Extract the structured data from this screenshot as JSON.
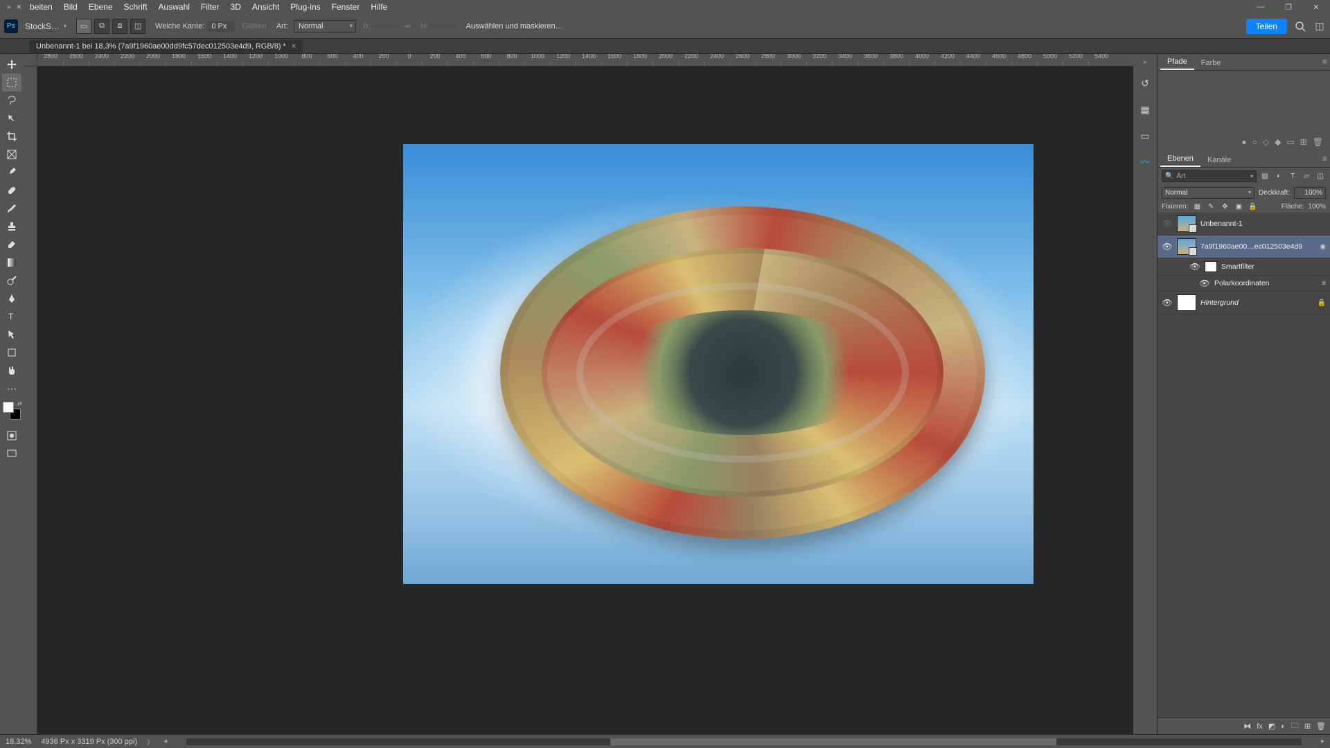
{
  "menu": {
    "items": [
      "beiten",
      "Bild",
      "Ebene",
      "Schrift",
      "Auswahl",
      "Filter",
      "3D",
      "Ansicht",
      "Plug-ins",
      "Fenster",
      "Hilfe"
    ]
  },
  "app": {
    "home_label": "StockS…"
  },
  "options": {
    "feather_label": "Weiche Kante:",
    "feather_value": "0 Px",
    "antialias": "Glätten",
    "style_label": "Art:",
    "style_value": "Normal",
    "width_label": "B:",
    "height_label": "H:",
    "mask_button": "Auswählen und maskieren…",
    "share": "Teilen"
  },
  "document": {
    "tab_title": "Unbenannt-1 bei 18,3% (7a9f1960ae00dd9fc57dec012503e4d9, RGB/8) *"
  },
  "ruler": {
    "ticks": [
      "2800",
      "2600",
      "2400",
      "2200",
      "2000",
      "1800",
      "1600",
      "1400",
      "1200",
      "1000",
      "800",
      "600",
      "400",
      "200",
      "0",
      "200",
      "400",
      "600",
      "800",
      "1000",
      "1200",
      "1400",
      "1600",
      "1800",
      "2000",
      "2200",
      "2400",
      "2600",
      "2800",
      "3000",
      "3200",
      "3400",
      "3600",
      "3800",
      "4000",
      "4200",
      "4400",
      "4600",
      "4800",
      "5000",
      "5200",
      "5400"
    ]
  },
  "panels": {
    "paths": {
      "tabs": [
        "Pfade",
        "Farbe"
      ]
    },
    "layers": {
      "tabs": [
        "Ebenen",
        "Kanäle"
      ],
      "filter_label": "Art",
      "blend": "Normal",
      "opacity_label": "Deckkraft:",
      "opacity_value": "100%",
      "lock_label": "Fixieren:",
      "fill_label": "Fläche:",
      "fill_value": "100%",
      "items": [
        {
          "name": "Unbenannt-1",
          "visible": false,
          "type": "smart"
        },
        {
          "name": "7a9f1960ae00…ec012503e4d9",
          "visible": true,
          "type": "smart",
          "selected": true
        },
        {
          "name": "Smartfilter",
          "visible": true,
          "type": "smartfilter"
        },
        {
          "name": "Polarkoordinaten",
          "visible": true,
          "type": "filter"
        },
        {
          "name": "Hintergrund",
          "visible": true,
          "type": "locked"
        }
      ]
    }
  },
  "status": {
    "zoom": "18.32%",
    "dims": "4936 Px x 3319 Px (300 ppi)"
  }
}
